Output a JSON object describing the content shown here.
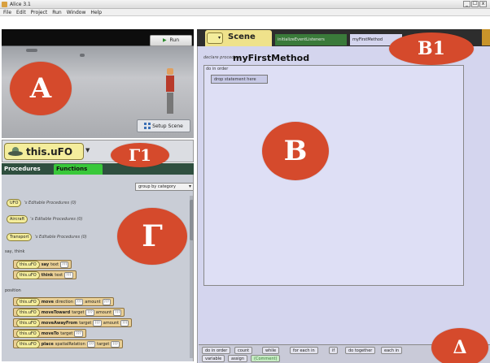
{
  "window": {
    "title": "Alice 3.1",
    "controls": [
      "_",
      "☐",
      "x"
    ]
  },
  "menu": [
    "File",
    "Edit",
    "Project",
    "Run",
    "Window",
    "Help"
  ],
  "scene_view": {
    "run_label": "Run",
    "setup_label": "Setup Scene"
  },
  "selected_object": "this.uFO",
  "tabs": {
    "procedures": "Procedures",
    "functions": "Functions"
  },
  "group_by": "group by category",
  "categories": [
    {
      "name": "UFO",
      "desc": "'s Editable Procedures (0)"
    },
    {
      "name": "Aircraft",
      "desc": "'s Editable Procedures (0)"
    },
    {
      "name": "Transport",
      "desc": "'s Editable Procedures (0)"
    }
  ],
  "sections": {
    "say_think": "say, think",
    "position": "position"
  },
  "methods": [
    {
      "target": "this.uFO",
      "name": "say",
      "params": [
        {
          "label": "text",
          "value": "???"
        }
      ]
    },
    {
      "target": "this.uFO",
      "name": "think",
      "params": [
        {
          "label": "text",
          "value": "???"
        }
      ]
    },
    {
      "target": "this.uFO",
      "name": "move",
      "params": [
        {
          "label": "direction",
          "value": "???"
        },
        {
          "label": "amount",
          "value": "???"
        }
      ]
    },
    {
      "target": "this.uFO",
      "name": "moveToward",
      "params": [
        {
          "label": "target",
          "value": "???"
        },
        {
          "label": "amount",
          "value": "???"
        }
      ]
    },
    {
      "target": "this.uFO",
      "name": "moveAwayFrom",
      "params": [
        {
          "label": "target",
          "value": "???"
        },
        {
          "label": "amount",
          "value": "???"
        }
      ]
    },
    {
      "target": "this.uFO",
      "name": "moveTo",
      "params": [
        {
          "label": "target",
          "value": "???"
        }
      ]
    },
    {
      "target": "this.uFO",
      "name": "place",
      "params": [
        {
          "label": "spatialRelation",
          "value": "???"
        },
        {
          "label": "target",
          "value": "???"
        }
      ]
    }
  ],
  "editor": {
    "scene_tab": "Scene",
    "events_tab": "initializeEventListeners",
    "method_tab": "myFirstMethod",
    "declare_label": "declare procedure",
    "method_name": "myFirstMethod",
    "do_in_order": "do in order",
    "drop_placeholder": "drop statement here"
  },
  "controls": [
    "do in order",
    "count",
    "while",
    "for each in",
    "if",
    "do together",
    "each in",
    "variable",
    "assign",
    "(Comment)"
  ],
  "annotations": {
    "A": "A",
    "G1": "Γ1",
    "G": "Γ",
    "B": "B",
    "B1": "B1",
    "D": "Δ"
  }
}
